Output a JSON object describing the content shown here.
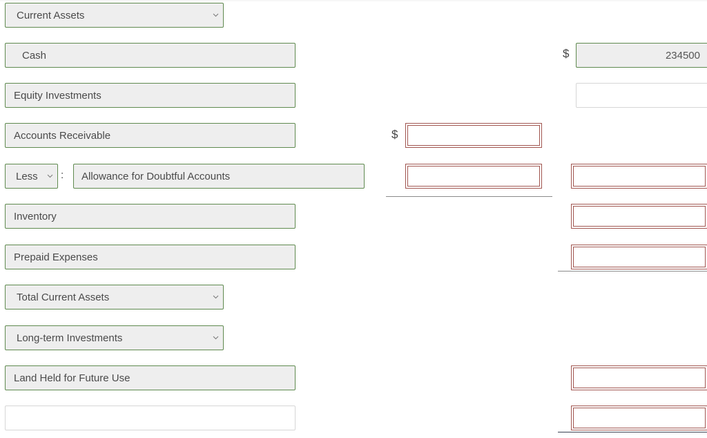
{
  "form": {
    "section_select": {
      "value": "Current Assets"
    },
    "rows": {
      "cash": {
        "label": "Cash",
        "currency": "$",
        "amount": "234500"
      },
      "equity_investments": {
        "label": "Equity Investments",
        "amount": ""
      },
      "accounts_receivable": {
        "label": "Accounts Receivable",
        "currency": "$",
        "amount": ""
      },
      "allowance": {
        "modifier": "Less",
        "separator": ":",
        "label": "Allowance for Doubtful Accounts",
        "amount": "",
        "net_amount": ""
      },
      "inventory": {
        "label": "Inventory",
        "amount": ""
      },
      "prepaid_expenses": {
        "label": "Prepaid Expenses",
        "amount": ""
      }
    },
    "total_select": {
      "value": "Total Current Assets"
    },
    "longterm_select": {
      "value": "Long-term Investments"
    },
    "land": {
      "label": "Land Held for Future Use",
      "amount": ""
    },
    "blank_row": {
      "label": "",
      "amount": ""
    }
  },
  "colors": {
    "field_border": "#5f8a4f",
    "error_border": "#a0554f",
    "field_bg": "#eeeeee"
  }
}
